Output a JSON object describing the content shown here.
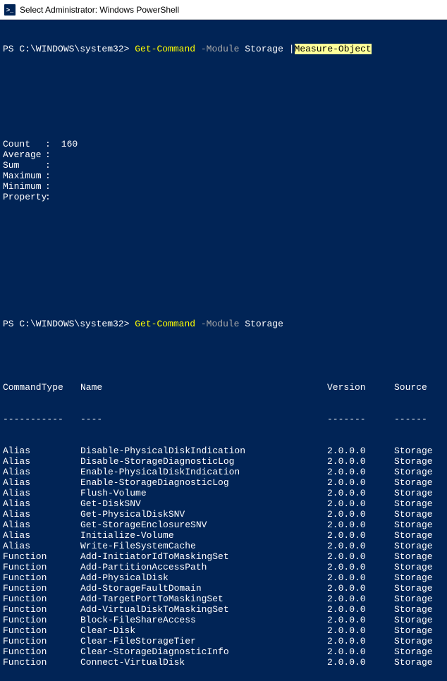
{
  "window": {
    "title": "Select Administrator: Windows PowerShell",
    "icon_glyph": ">_"
  },
  "line1": {
    "prompt": "PS C:\\WINDOWS\\system32> ",
    "cmd": "Get-Command",
    "param": " -Module",
    "arg": " Storage ",
    "pipe": "|",
    "cmd2": "Measure-Object"
  },
  "stats": [
    {
      "label": "Count",
      "value": "160"
    },
    {
      "label": "Average",
      "value": ""
    },
    {
      "label": "Sum",
      "value": ""
    },
    {
      "label": "Maximum",
      "value": ""
    },
    {
      "label": "Minimum",
      "value": ""
    },
    {
      "label": "Property",
      "value": ""
    }
  ],
  "line2": {
    "prompt": "PS C:\\WINDOWS\\system32> ",
    "cmd": "Get-Command",
    "param": " -Module",
    "arg": " Storage"
  },
  "headers": {
    "type": "CommandType",
    "name": "Name",
    "version": "Version",
    "source": "Source",
    "type_u": "-----------",
    "name_u": "----",
    "version_u": "-------",
    "source_u": "------"
  },
  "rows": [
    {
      "type": "Alias",
      "name": "Disable-PhysicalDiskIndication",
      "version": "2.0.0.0",
      "source": "Storage"
    },
    {
      "type": "Alias",
      "name": "Disable-StorageDiagnosticLog",
      "version": "2.0.0.0",
      "source": "Storage"
    },
    {
      "type": "Alias",
      "name": "Enable-PhysicalDiskIndication",
      "version": "2.0.0.0",
      "source": "Storage"
    },
    {
      "type": "Alias",
      "name": "Enable-StorageDiagnosticLog",
      "version": "2.0.0.0",
      "source": "Storage"
    },
    {
      "type": "Alias",
      "name": "Flush-Volume",
      "version": "2.0.0.0",
      "source": "Storage"
    },
    {
      "type": "Alias",
      "name": "Get-DiskSNV",
      "version": "2.0.0.0",
      "source": "Storage"
    },
    {
      "type": "Alias",
      "name": "Get-PhysicalDiskSNV",
      "version": "2.0.0.0",
      "source": "Storage"
    },
    {
      "type": "Alias",
      "name": "Get-StorageEnclosureSNV",
      "version": "2.0.0.0",
      "source": "Storage"
    },
    {
      "type": "Alias",
      "name": "Initialize-Volume",
      "version": "2.0.0.0",
      "source": "Storage"
    },
    {
      "type": "Alias",
      "name": "Write-FileSystemCache",
      "version": "2.0.0.0",
      "source": "Storage"
    },
    {
      "type": "Function",
      "name": "Add-InitiatorIdToMaskingSet",
      "version": "2.0.0.0",
      "source": "Storage"
    },
    {
      "type": "Function",
      "name": "Add-PartitionAccessPath",
      "version": "2.0.0.0",
      "source": "Storage"
    },
    {
      "type": "Function",
      "name": "Add-PhysicalDisk",
      "version": "2.0.0.0",
      "source": "Storage"
    },
    {
      "type": "Function",
      "name": "Add-StorageFaultDomain",
      "version": "2.0.0.0",
      "source": "Storage"
    },
    {
      "type": "Function",
      "name": "Add-TargetPortToMaskingSet",
      "version": "2.0.0.0",
      "source": "Storage"
    },
    {
      "type": "Function",
      "name": "Add-VirtualDiskToMaskingSet",
      "version": "2.0.0.0",
      "source": "Storage"
    },
    {
      "type": "Function",
      "name": "Block-FileShareAccess",
      "version": "2.0.0.0",
      "source": "Storage"
    },
    {
      "type": "Function",
      "name": "Clear-Disk",
      "version": "2.0.0.0",
      "source": "Storage"
    },
    {
      "type": "Function",
      "name": "Clear-FileStorageTier",
      "version": "2.0.0.0",
      "source": "Storage"
    },
    {
      "type": "Function",
      "name": "Clear-StorageDiagnosticInfo",
      "version": "2.0.0.0",
      "source": "Storage"
    },
    {
      "type": "Function",
      "name": "Connect-VirtualDisk",
      "version": "2.0.0.0",
      "source": "Storage"
    }
  ]
}
